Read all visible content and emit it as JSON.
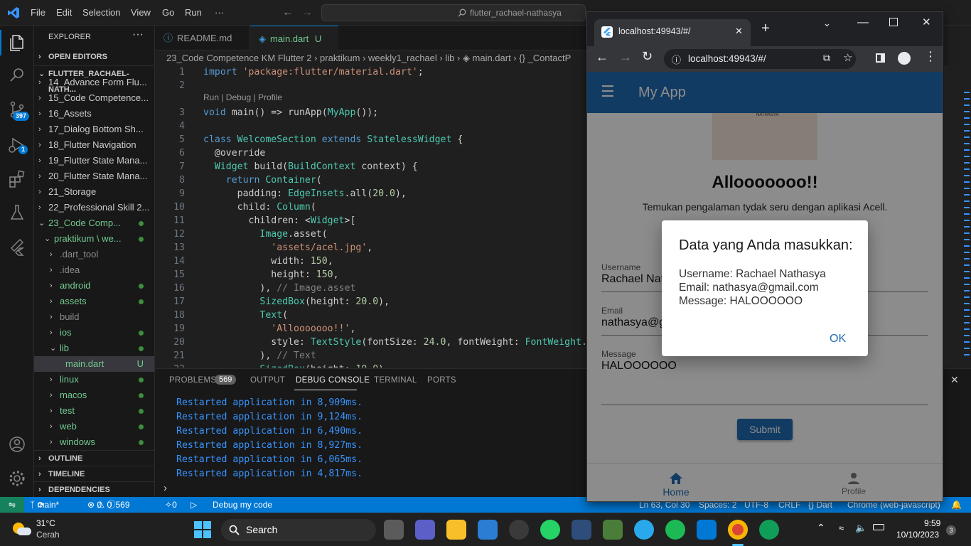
{
  "vscode": {
    "menu": [
      "File",
      "Edit",
      "Selection",
      "View",
      "Go",
      "Run",
      "···"
    ],
    "search_text": "flutter_rachael-nathasya",
    "activity_badges": {
      "source_control": "397",
      "debug": "1"
    },
    "explorer": {
      "title": "EXPLORER",
      "open_editors": "OPEN EDITORS",
      "root": "FLUTTER_RACHAEL-NATH...",
      "items": [
        {
          "label": "14_Advance Form Flu...",
          "depth": 1,
          "chev": "›",
          "color": "#cccccc",
          "dot": false
        },
        {
          "label": "15_Code Competence...",
          "depth": 1,
          "chev": "›",
          "color": "#cccccc",
          "dot": false
        },
        {
          "label": "16_Assets",
          "depth": 1,
          "chev": "›",
          "color": "#cccccc",
          "dot": false
        },
        {
          "label": "17_Dialog Bottom Sh...",
          "depth": 1,
          "chev": "›",
          "color": "#cccccc",
          "dot": false
        },
        {
          "label": "18_Flutter Navigation",
          "depth": 1,
          "chev": "›",
          "color": "#cccccc",
          "dot": false
        },
        {
          "label": "19_Flutter State Mana...",
          "depth": 1,
          "chev": "›",
          "color": "#cccccc",
          "dot": false
        },
        {
          "label": "20_Flutter State Mana...",
          "depth": 1,
          "chev": "›",
          "color": "#cccccc",
          "dot": false
        },
        {
          "label": "21_Storage",
          "depth": 1,
          "chev": "›",
          "color": "#cccccc",
          "dot": false
        },
        {
          "label": "22_Professional Skill 2...",
          "depth": 1,
          "chev": "›",
          "color": "#cccccc",
          "dot": false
        },
        {
          "label": "23_Code Comp...",
          "depth": 1,
          "chev": "⌄",
          "color": "#73c991",
          "dot": true
        },
        {
          "label": "praktikum \\ we...",
          "depth": 2,
          "chev": "⌄",
          "color": "#73c991",
          "dot": true
        },
        {
          "label": ".dart_tool",
          "depth": 3,
          "chev": "›",
          "color": "#8c8c8c",
          "dot": false
        },
        {
          "label": ".idea",
          "depth": 3,
          "chev": "›",
          "color": "#8c8c8c",
          "dot": false
        },
        {
          "label": "android",
          "depth": 3,
          "chev": "›",
          "color": "#73c991",
          "dot": true
        },
        {
          "label": "assets",
          "depth": 3,
          "chev": "›",
          "color": "#73c991",
          "dot": true
        },
        {
          "label": "build",
          "depth": 3,
          "chev": "›",
          "color": "#8c8c8c",
          "dot": false
        },
        {
          "label": "ios",
          "depth": 3,
          "chev": "›",
          "color": "#73c991",
          "dot": true
        },
        {
          "label": "lib",
          "depth": 3,
          "chev": "⌄",
          "color": "#73c991",
          "dot": true
        },
        {
          "label": "main.dart",
          "depth": 4,
          "chev": "",
          "color": "#73c991",
          "dot": false,
          "flag": "U",
          "selected": true
        },
        {
          "label": "linux",
          "depth": 3,
          "chev": "›",
          "color": "#73c991",
          "dot": true
        },
        {
          "label": "macos",
          "depth": 3,
          "chev": "›",
          "color": "#73c991",
          "dot": true
        },
        {
          "label": "test",
          "depth": 3,
          "chev": "›",
          "color": "#73c991",
          "dot": true
        },
        {
          "label": "web",
          "depth": 3,
          "chev": "›",
          "color": "#73c991",
          "dot": true
        },
        {
          "label": "windows",
          "depth": 3,
          "chev": "›",
          "color": "#73c991",
          "dot": true
        }
      ],
      "sections": [
        "OUTLINE",
        "TIMELINE",
        "DEPENDENCIES"
      ]
    },
    "tabs": [
      {
        "label": "README.md",
        "active": false
      },
      {
        "label": "main.dart",
        "flag": "U",
        "active": true
      }
    ],
    "breadcrumb": "23_Code Competence KM Flutter 2 › praktikum › weekly1_rachael › lib › ◈ main.dart › {} _ContactP",
    "codelens": "Run | Debug | Profile",
    "line_numbers": [
      "1",
      "2",
      "3",
      "4",
      "5",
      "6",
      "7",
      "8",
      "9",
      "10",
      "11",
      "12",
      "13",
      "14",
      "15",
      "16",
      "17",
      "18",
      "19",
      "20",
      "21",
      "22"
    ],
    "code_lines": [
      "import 'package:flutter/material.dart';",
      "",
      "void main() => runApp(MyApp());",
      "",
      "class WelcomeSection extends StatelessWidget {",
      "  @override",
      "  Widget build(BuildContext context) {",
      "    return Container(",
      "      padding: EdgeInsets.all(20.0),",
      "      child: Column(",
      "        children: <Widget>[",
      "          Image.asset(",
      "            'assets/acel.jpg',",
      "            width: 150,",
      "            height: 150,",
      "          ), // Image.asset",
      "          SizedBox(height: 20.0),",
      "          Text(",
      "            'Allooooooo!!',",
      "            style: TextStyle(fontSize: 24.0, fontWeight: FontWeight.bo",
      "          ), // Text",
      "          SizedBox(height: 10.0),"
    ],
    "panel": {
      "tabs": [
        "PROBLEMS",
        "OUTPUT",
        "DEBUG CONSOLE",
        "TERMINAL",
        "PORTS"
      ],
      "problems_count": "569",
      "active_tab": "DEBUG CONSOLE",
      "log_lines": [
        "Restarted application in 8,909ms.",
        "Restarted application in 9,124ms.",
        "Restarted application in 6,490ms.",
        "Restarted application in 8,927ms.",
        "Restarted application in 6,065ms.",
        "Restarted application in 4,817ms."
      ],
      "prompt": "›"
    },
    "status": {
      "branch": "main*",
      "errors": "0",
      "warnings": "0",
      "info": "569",
      "ports": "0",
      "debug": "Debug my code",
      "position": "Ln 63, Col 30",
      "spaces": "Spaces: 2",
      "encoding": "UTF-8",
      "eol": "CRLF",
      "language": "{} Dart",
      "device": "Chrome (web-javascript)"
    }
  },
  "chrome": {
    "tab_title": "localhost:49943/#/",
    "url": "localhost:49943/#/",
    "app": {
      "title": "My App",
      "image_caption": "NATHASYA",
      "heading": "Allooooooo!!",
      "subtitle": "Temukan pengalaman tydak seru dengan aplikasi Acell.",
      "username_label": "Username",
      "username_value": "Rachael Nathasya",
      "email_label": "Email",
      "email_value": "nathasya@gmail.com",
      "message_label": "Message",
      "message_value": "HALOOOOOO",
      "submit": "Submit",
      "nav_home": "Home",
      "nav_profile": "Profile",
      "primary_color": "#1f6cb4"
    },
    "dialog": {
      "title": "Data yang Anda masukkan:",
      "line1": "Username: Rachael Nathasya",
      "line2": "Email: nathasya@gmail.com",
      "line3": "Message: HALOOOOOO",
      "ok": "OK"
    }
  },
  "taskbar": {
    "weather_temp": "31°C",
    "weather_desc": "Cerah",
    "search": "Search",
    "time": "9:59",
    "date": "10/10/2023",
    "notif": "3"
  }
}
